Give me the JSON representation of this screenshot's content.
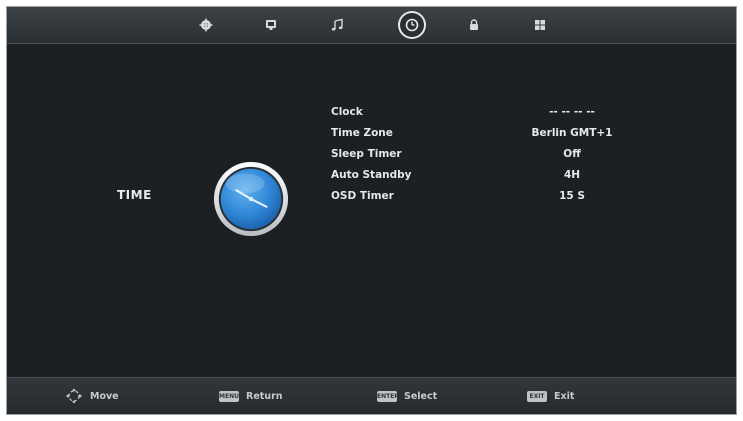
{
  "top_menu": {
    "tabs": [
      {
        "icon": "picture-icon"
      },
      {
        "icon": "tv-monitor-icon"
      },
      {
        "icon": "music-note-icon"
      },
      {
        "icon": "clock-icon",
        "active": true
      },
      {
        "icon": "lock-icon"
      },
      {
        "icon": "setup-grid-icon"
      }
    ]
  },
  "page": {
    "title": "TIME"
  },
  "settings": [
    {
      "label": "Clock",
      "value": "-- -- -- --"
    },
    {
      "label": "Time Zone",
      "value": "Berlin GMT+1"
    },
    {
      "label": "Sleep Timer",
      "value": "Off"
    },
    {
      "label": "Auto Standby",
      "value": "4H"
    },
    {
      "label": "OSD Timer",
      "value": "15 S"
    }
  ],
  "footer": {
    "move_label": "Move",
    "return_key": "MENU",
    "return_label": "Return",
    "select_key": "ENTER",
    "select_label": "Select",
    "exit_key": "EXIT",
    "exit_label": "Exit"
  },
  "colors": {
    "background": "#1c2023",
    "text": "#e6e8ea",
    "clock_blue": "#2f86d6"
  }
}
